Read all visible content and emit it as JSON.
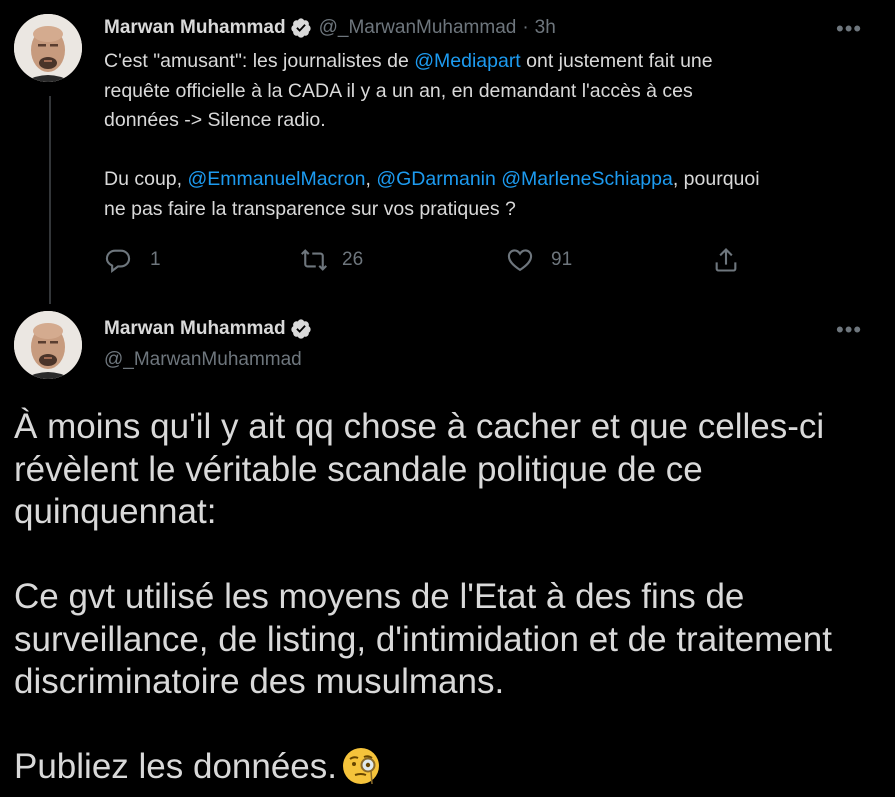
{
  "parent_tweet": {
    "author_name": "Marwan Muhammad",
    "handle": "@_MarwanMuhammad",
    "separator": "·",
    "time": "3h",
    "more": "•••",
    "text_line1_a": "C'est \"amusant\": les journalistes de ",
    "mention_mediapart": "@Mediapart",
    "text_line1_b": " ont justement fait une",
    "text_line2": "requête officielle à la CADA il y a un an, en demandant l'accès à ces",
    "text_line3": "données -> Silence radio.",
    "text_line4_a": "Du coup, ",
    "mention_macron": "@EmmanuelMacron",
    "text_line4_b": ", ",
    "mention_darmanin": "@GDarmanin",
    "text_line4_c": " ",
    "mention_schiappa": "@MarleneSchiappa",
    "text_line4_d": ", pourquoi",
    "text_line5": "ne pas faire la transparence sur vos pratiques ?",
    "reply_count": "1",
    "retweet_count": "26",
    "like_count": "91"
  },
  "main_tweet": {
    "author_name": "Marwan Muhammad",
    "handle": "@_MarwanMuhammad",
    "more": "•••",
    "para1_line1": "À moins qu'il y ait qq chose à cacher et que celles-ci",
    "para1_line2": "révèlent le véritable scandale politique de ce",
    "para1_line3": "quinquennat:",
    "para2_line1": "Ce gvt utilisé les moyens de l'Etat à des fins de",
    "para2_line2": "surveillance, de listing, d'intimidation et de traitement",
    "para2_line3": "discriminatoire des musulmans.",
    "para3": "Publiez les données."
  },
  "colors": {
    "background": "#000000",
    "text": "#D9D9D9",
    "muted": "#6E767D",
    "link": "#1D9BF0",
    "thread_line": "#333639"
  },
  "icons": [
    "verified-badge-icon",
    "reply-icon",
    "retweet-icon",
    "like-icon",
    "share-icon",
    "more-icon",
    "monocle-face-emoji"
  ]
}
